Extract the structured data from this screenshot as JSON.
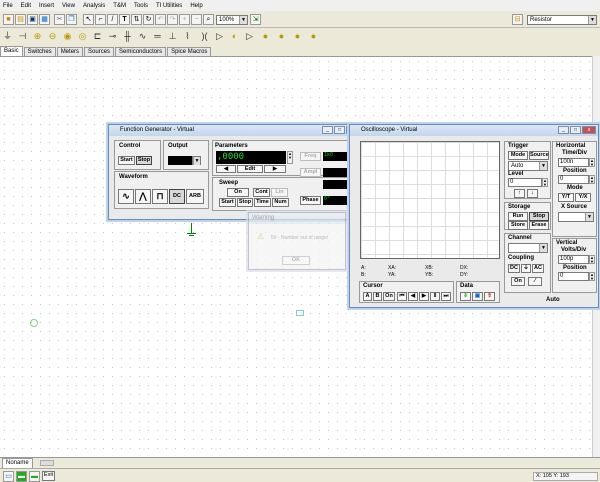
{
  "menu": [
    "File",
    "Edit",
    "Insert",
    "View",
    "Analysis",
    "T&M",
    "Tools",
    "TI Utilities",
    "Help"
  ],
  "toolbar": {
    "zoom": "100%",
    "component_combo": "Resistor"
  },
  "tabs": [
    "Basic",
    "Switches",
    "Meters",
    "Sources",
    "Semiconductors",
    "Spice Macros"
  ],
  "bottom_tab": "Noname",
  "status": {
    "exit_label": "Exit",
    "coords": "X: 105 Y: 193"
  },
  "function_generator": {
    "title": "Function Generator - Virtual",
    "control_label": "Control",
    "start": "Start",
    "stop": "Stop",
    "output_label": "Output",
    "waveform_label": "Waveform",
    "dc": "DC",
    "arb": "ARB",
    "parameters_label": "Parameters",
    "param_value": ",0000",
    "edit": "Edit",
    "freq_label": "Freq",
    "freq_value": "1k0",
    "ampl_label": "Ampl",
    "phase_label": "Phase",
    "phase_value": "0°",
    "sweep_label": "Sweep",
    "on": "On",
    "cont": "Cont",
    "lin": "Lin",
    "sweep_start": "Start",
    "sweep_stop": "Stop",
    "time": "Time",
    "num": "Num"
  },
  "oscilloscope": {
    "title": "Oscilloscope - Virtual",
    "trigger_label": "Trigger",
    "mode_btn": "Mode",
    "source_btn": "Source",
    "trigger_mode": "Auto",
    "level_label": "Level",
    "level_value": "0",
    "horizontal_label": "Horizontal",
    "time_div_label": "Time/Div",
    "time_div_value": "100n",
    "position_label": "Position",
    "position_value": "0",
    "mode_label": "Mode",
    "yt": "Y/T",
    "yx": "Y/X",
    "xsource_label": "X Source",
    "storage_label": "Storage",
    "run": "Run",
    "stop": "Stop",
    "store": "Store",
    "erase": "Erase",
    "channel_label": "Channel",
    "coupling_label": "Coupling",
    "dc": "DC",
    "ac": "AC",
    "on": "On",
    "vertical_label": "Vertical",
    "volts_div_label": "Volts/Div",
    "volts_div_value": "100p",
    "vpos_label": "Position",
    "vpos_value": "0",
    "cursor_label": "Cursor",
    "cursor_a": "A",
    "cursor_b": "B",
    "cursor_on": "On",
    "data_label": "Data",
    "auto_label": "Auto",
    "readouts": [
      "A:",
      "XA:",
      "XB:",
      "DX:",
      "B:",
      "YA:",
      "YB:",
      "DY:"
    ]
  },
  "warning": {
    "title": "Warning",
    "message": "5# - Number out of range!",
    "ok": "OK"
  }
}
